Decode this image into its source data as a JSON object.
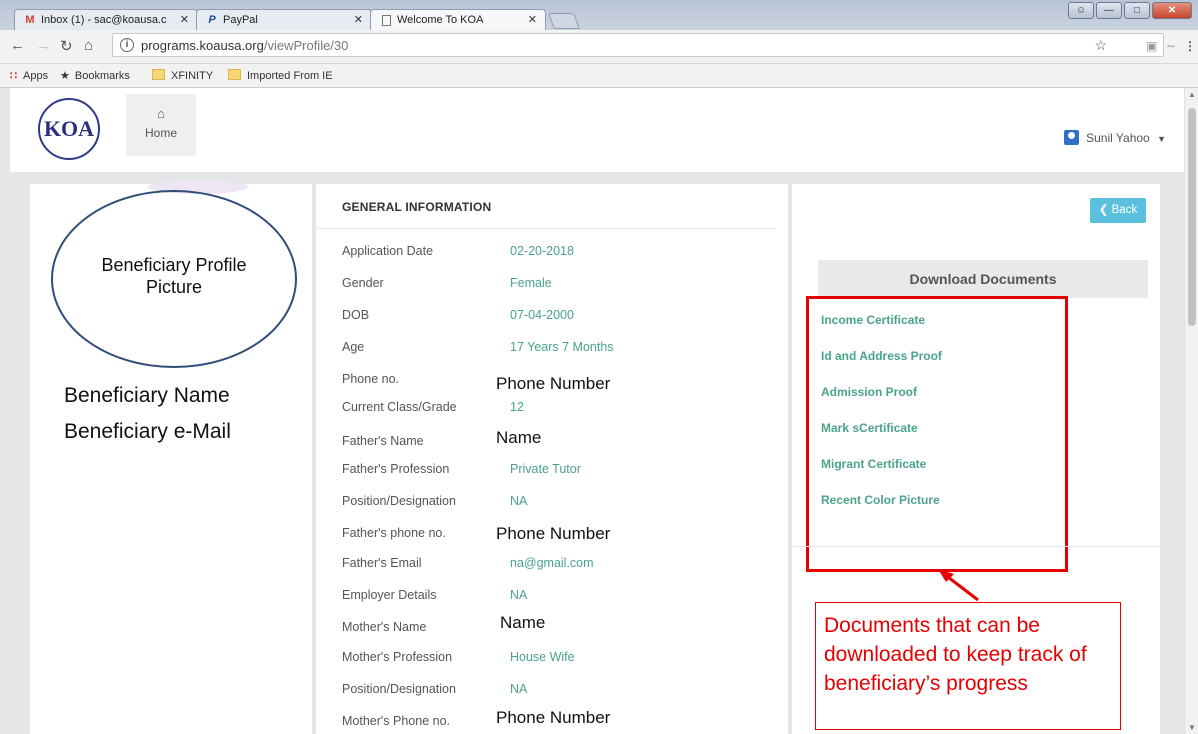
{
  "browser": {
    "tabs": [
      {
        "icon": "M",
        "title": "Inbox (1) - sac@koausa.c"
      },
      {
        "icon": "P",
        "title": "PayPal"
      },
      {
        "icon": "",
        "title": "Welcome To KOA"
      }
    ],
    "url_host": "programs.koausa.org",
    "url_path": "/viewProfile/30",
    "bookmarks": [
      "Apps",
      "Bookmarks",
      "XFINITY",
      "Imported From IE"
    ]
  },
  "navbar": {
    "logo_text": "KOA",
    "home_label": "Home",
    "user_name": "Sunil Yahoo"
  },
  "profile": {
    "picture_label": "Beneficiary Profile Picture",
    "name": "Beneficiary Name",
    "email": "Beneficiary e-Mail"
  },
  "general": {
    "title": "GENERAL INFORMATION",
    "rows": [
      {
        "key": "Application Date",
        "value": "02-20-2018"
      },
      {
        "key": "Gender",
        "value": "Female"
      },
      {
        "key": "DOB",
        "value": "07-04-2000"
      },
      {
        "key": "Age",
        "value": "17 Years 7 Months"
      },
      {
        "key": "Phone no.",
        "value": "Phone Number"
      },
      {
        "key": "Current Class/Grade",
        "value": "12"
      },
      {
        "key": "Father's Name",
        "value": "Name"
      },
      {
        "key": "Father's Profession",
        "value": "Private Tutor"
      },
      {
        "key": "Position/Designation",
        "value": "NA"
      },
      {
        "key": "Father's phone no.",
        "value": "Phone Number"
      },
      {
        "key": "Father's Email",
        "value": "na@gmail.com"
      },
      {
        "key": "Employer Details",
        "value": "NA"
      },
      {
        "key": "Mother's Name",
        "value": "Name"
      },
      {
        "key": "Mother's Profession",
        "value": "House Wife"
      },
      {
        "key": "Position/Designation",
        "value": "NA"
      },
      {
        "key": "Mother's Phone no.",
        "value": "Phone Number"
      }
    ]
  },
  "documents": {
    "back_label": "Back",
    "header": "Download Documents",
    "items": [
      "Income Certificate",
      "Id and Address Proof",
      "Admission Proof",
      "Mark sCertificate",
      "Migrant Certificate",
      "Recent Color Picture"
    ],
    "callout": "Documents that can be downloaded to keep track of beneficiary’s progress"
  },
  "colors": {
    "accent_green": "#4aa38a",
    "back_button": "#5bc0de",
    "annotation_red": "#e60000"
  }
}
